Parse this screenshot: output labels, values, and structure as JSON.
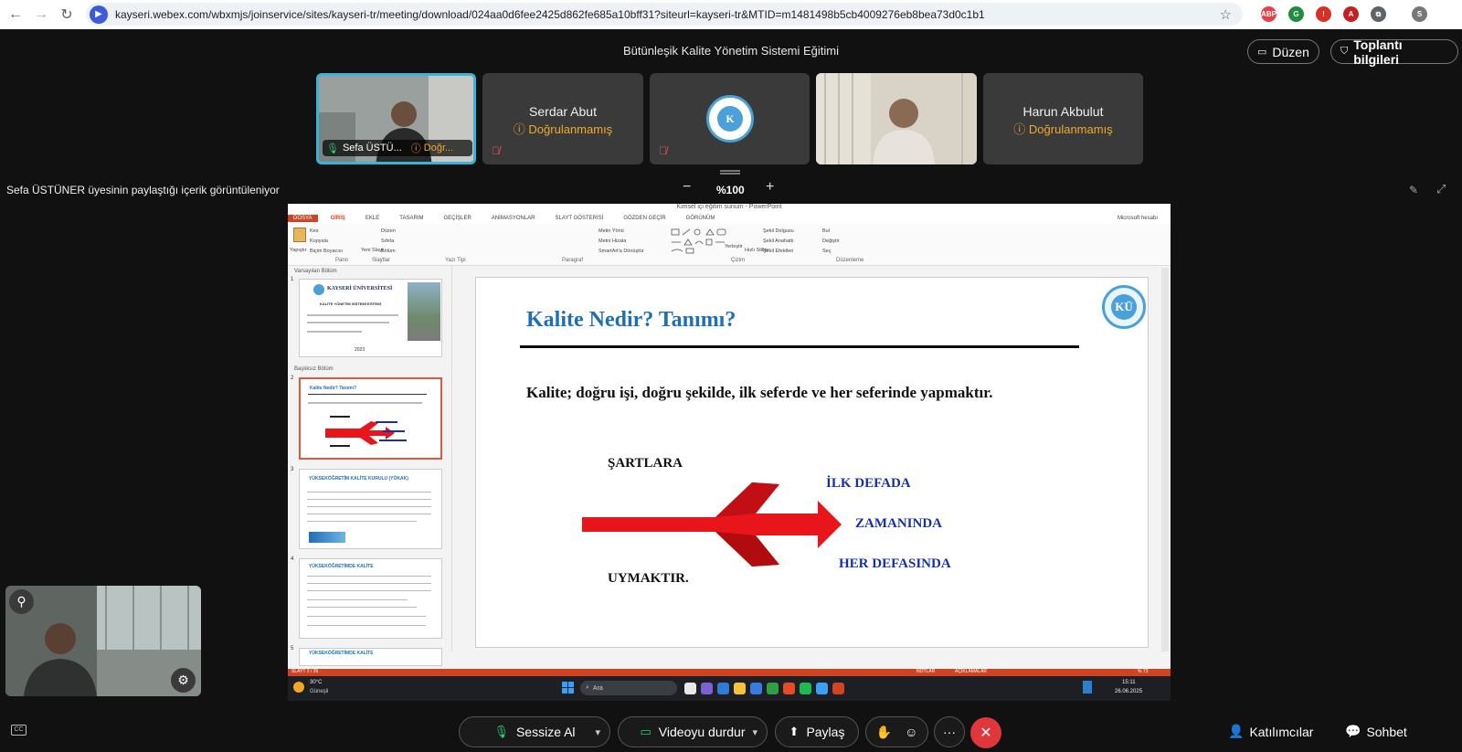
{
  "browser": {
    "back": "←",
    "forward": "→",
    "reload": "↻",
    "url": "kayseri.webex.com/wbxmjs/joinservice/sites/kayseri-tr/meeting/download/024aa0d6fee2425d862fe685a10bff31?siteurl=kayseri-tr&MTID=m1481498b5cb4009276eb8bea73d0c1b1",
    "star": "☆",
    "extensions": [
      {
        "label": "ABP",
        "color": "#e8404a"
      },
      {
        "label": "G",
        "color": "#1e8e3e"
      },
      {
        "label": "!",
        "color": "#d93025"
      },
      {
        "label": "A",
        "color": "#c5221f"
      },
      {
        "label": "⧉",
        "color": "#5f6368"
      },
      {
        "label": "S",
        "color": "#777777"
      }
    ]
  },
  "meeting": {
    "title": "Bütünleşik Kalite Yönetim Sistemi Eğitimi",
    "layout_btn": "Düzen",
    "info_btn": "Toplantı bilgileri"
  },
  "participants": [
    {
      "name": "Sefa ÜSTÜ...",
      "status": "Doğr..."
    },
    {
      "name": "Serdar Abut",
      "status": "Doğrulanmamış"
    },
    {
      "name": "",
      "status": ""
    },
    {
      "name": "",
      "status": ""
    },
    {
      "name": "Harun Akbulut",
      "status": "Doğrulanmamış"
    }
  ],
  "share": {
    "label": "Sefa ÜSTÜNER üyesinin paylaştığı içerik görüntüleniyor",
    "zoom_minus": "−",
    "zoom": "%100",
    "zoom_plus": "+"
  },
  "ppt": {
    "window_title": "Kimsel içi eğitim sunum - PowerPoint",
    "account": "Microsoft hesabı",
    "tabs": [
      "DOSYA",
      "GİRİŞ",
      "EKLE",
      "TASARIM",
      "GEÇİŞLER",
      "ANİMASYONLAR",
      "SLAYT GÖSTERİSİ",
      "GÖZDEN GEÇİR",
      "GÖRÜNÜM"
    ],
    "groups": [
      "Pano",
      "Slaytlar",
      "Yazı Tipi",
      "Paragraf",
      "Çizim",
      "Düzenleme"
    ],
    "ribbon_items": [
      "Yapıştır",
      "Kes",
      "Kopyala",
      "Biçim Boyacısı",
      "Yeni Slayt",
      "Düzen",
      "Sıfırla",
      "Bölüm",
      "Metin Yönü",
      "Metni Hizala",
      "SmartArt'a Dönüştür",
      "Yerleştir",
      "Hızlı Stiller",
      "Şekil Dolgusu",
      "Şekil Anahattı",
      "Şekil Efektleri",
      "Bul",
      "Değiştir",
      "Seç"
    ],
    "sections": [
      "Varsayılan Bölüm",
      "Başlıksız Bölüm"
    ],
    "thumbs": [
      {
        "num": "1",
        "title": "KAYSERİ ÜNİVERSİTESİ",
        "sub": "KALİTE YÖNETİM SİSTEMİ EĞİTİMİ",
        "year": "2023"
      },
      {
        "num": "2",
        "title": "Kalite Nedir? Tanımı?"
      },
      {
        "num": "3",
        "title": "YÜKSEKÖĞRETİM KALİTE KURULU (YÖKAK)"
      },
      {
        "num": "4",
        "title": "YÜKSEKÖĞRETİMDE KALİTE"
      },
      {
        "num": "5",
        "title": "YÜKSEKÖĞRETİMDE KALİTE"
      }
    ],
    "slide": {
      "title": "Kalite Nedir? Tanımı?",
      "text": "Kalite; doğru işi, doğru şekilde, ilk seferde ve her seferinde yapmaktır.",
      "left_top": "ŞARTLARA",
      "left_bottom": "UYMAKTIR.",
      "right_1": "İLK DEFADA",
      "right_2": "ZAMANINDA",
      "right_3": "HER DEFASINDA",
      "logo_text": "KÜ"
    },
    "status_left": "SLAYT 2 / 26",
    "status_right": [
      "NOTLAR",
      "AÇIKLAMALAR",
      "% 73"
    ],
    "taskbar": {
      "weather": "30°C",
      "weather_desc": "Güneşli",
      "search": "Ara",
      "time": "15:11",
      "date": "26.06.2025"
    }
  },
  "controls": {
    "mute": "Sessize Al",
    "video": "Videoyu durdur",
    "share": "Paylaş",
    "more": "···",
    "end": "✕",
    "participants": "Katılımcılar",
    "chat": "Sohbet"
  },
  "colors": {
    "accent_red": "#e0373c",
    "warn": "#f0a830",
    "active_speaker": "#3ab4d6",
    "slide_blue": "#1f6fb8",
    "arrow_red": "#e8151b"
  }
}
